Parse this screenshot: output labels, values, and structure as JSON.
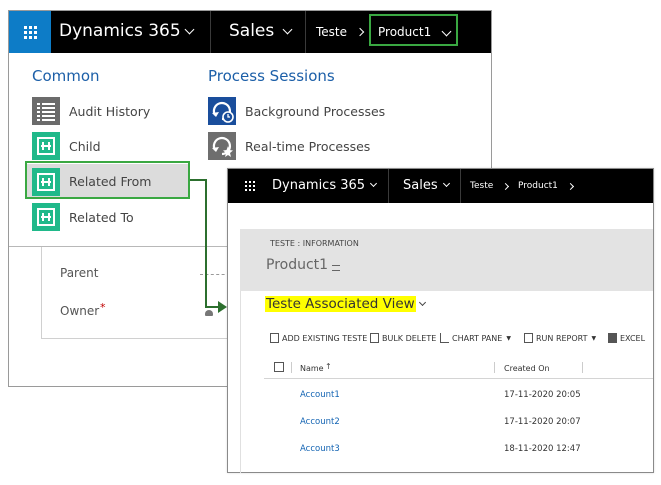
{
  "back_window": {
    "nav": {
      "app": "Dynamics 365",
      "area": "Sales",
      "crumb1": "Teste",
      "crumb2": "Product1"
    },
    "menu": {
      "common_title": "Common",
      "process_title": "Process Sessions",
      "common_items": [
        {
          "label": "Audit History",
          "icon": "audit-history-icon"
        },
        {
          "label": "Child",
          "icon": "entity-icon"
        },
        {
          "label": "Related From",
          "icon": "entity-icon"
        },
        {
          "label": "Related To",
          "icon": "entity-icon"
        }
      ],
      "process_items": [
        {
          "label": "Background Processes",
          "icon": "background-process-icon"
        },
        {
          "label": "Real-time Processes",
          "icon": "realtime-process-icon"
        }
      ]
    },
    "form": {
      "parent_label": "Parent",
      "owner_label": "Owner",
      "required_mark": "*"
    }
  },
  "front_window": {
    "nav": {
      "app": "Dynamics 365",
      "area": "Sales",
      "crumb1": "Teste",
      "crumb2": "Product1"
    },
    "entity_header": "TESTE : INFORMATION",
    "record_name": "Product1",
    "view_name": "Teste Associated View",
    "commands": [
      "ADD EXISTING TESTE",
      "BULK DELETE",
      "CHART PANE",
      "RUN REPORT",
      "EXCEL"
    ],
    "columns": {
      "name": "Name",
      "created": "Created On"
    },
    "rows": [
      {
        "name": "Account1",
        "created": "17-11-2020 20:05"
      },
      {
        "name": "Account2",
        "created": "17-11-2020 20:07"
      },
      {
        "name": "Account3",
        "created": "18-11-2020 12:47"
      }
    ]
  },
  "colors": {
    "accent_blue": "#0d7cc7",
    "teal_icon": "#20b98a",
    "highlight_green": "#3aa842",
    "link_blue": "#1364b3",
    "view_highlight": "#ffff00"
  }
}
